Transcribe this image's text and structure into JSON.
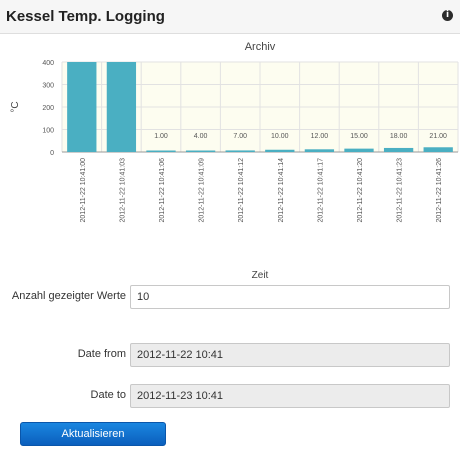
{
  "panel": {
    "title": "Kessel Temp. Logging",
    "info_icon": "info-icon"
  },
  "chart_data": {
    "type": "bar",
    "title": "Archiv",
    "xlabel": "Zeit",
    "ylabel": "°C",
    "ylim": [
      0,
      400
    ],
    "yticks": [
      0,
      100,
      200,
      300,
      400
    ],
    "categories": [
      "2012-11-22 10:41:00",
      "2012-11-22 10:41:03",
      "2012-11-22 10:41:06",
      "2012-11-22 10:41:09",
      "2012-11-22 10:41:12",
      "2012-11-22 10:41:14",
      "2012-11-22 10:41:17",
      "2012-11-22 10:41:20",
      "2012-11-22 10:41:23",
      "2012-11-22 10:41:26"
    ],
    "values": [
      400,
      400,
      1,
      4,
      7,
      10,
      12,
      15,
      18,
      21
    ],
    "data_labels": [
      "",
      "",
      "1.00",
      "4.00",
      "7.00",
      "10.00",
      "12.00",
      "15.00",
      "18.00",
      "21.00"
    ],
    "bar_color": "#4aafc2",
    "grid": true
  },
  "form": {
    "count_label": "Anzahl gezeigter Werte",
    "count_value": "10",
    "date_from_label": "Date from",
    "date_from_value": "2012-11-22 10:41",
    "date_to_label": "Date to",
    "date_to_value": "2012-11-23 10:41",
    "submit_label": "Aktualisieren"
  },
  "colors": {
    "button": "#0b6fd0",
    "bar": "#4aafc2",
    "plot_bg": "#fdfdf0"
  }
}
